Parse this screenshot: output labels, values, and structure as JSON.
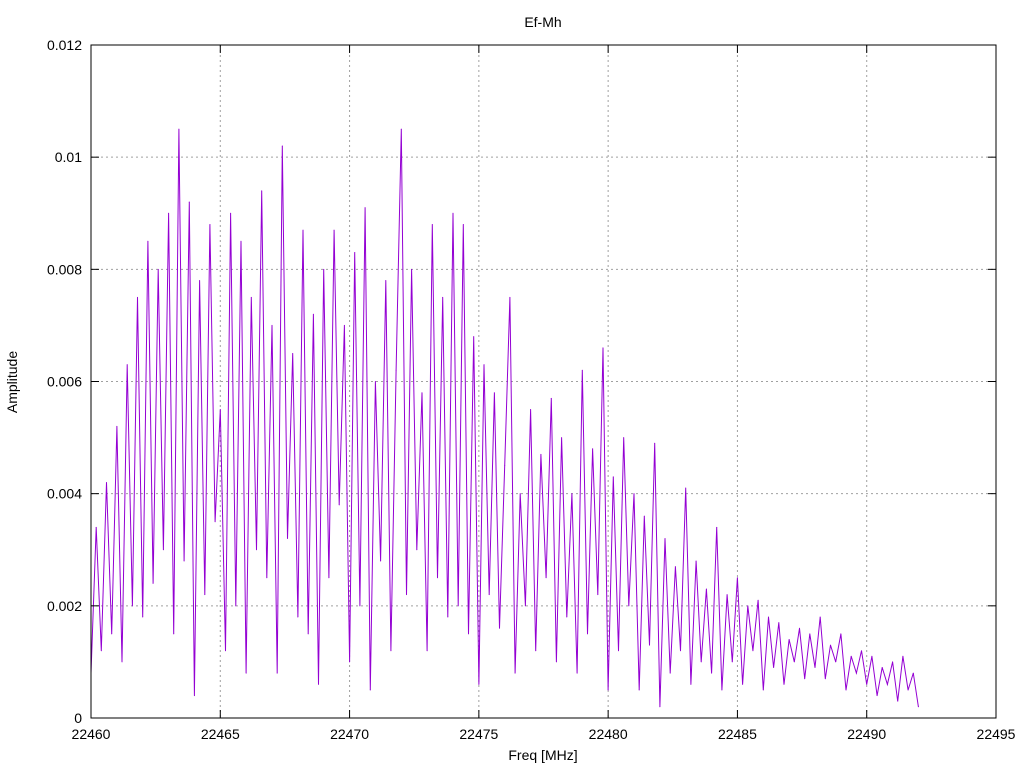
{
  "chart_data": {
    "type": "line",
    "title": "Ef-Mh",
    "xlabel": "Freq [MHz]",
    "ylabel": "Amplitude",
    "xlim": [
      22460,
      22495
    ],
    "ylim": [
      0,
      0.012
    ],
    "grid": true,
    "legend": "none",
    "xticks": [
      "22460",
      "22465",
      "22470",
      "22475",
      "22480",
      "22485",
      "22490",
      "22495"
    ],
    "yticks": [
      "0",
      "0.002",
      "0.004",
      "0.006",
      "0.008",
      "0.01",
      "0.012"
    ],
    "series": [
      {
        "name": "Ef-Mh",
        "color": "#9400D3",
        "x_start": 22460,
        "x_step": 0.2,
        "values": [
          0.0008,
          0.0034,
          0.0012,
          0.0042,
          0.0015,
          0.0052,
          0.001,
          0.0063,
          0.002,
          0.0075,
          0.0018,
          0.0085,
          0.0024,
          0.008,
          0.003,
          0.009,
          0.0015,
          0.0105,
          0.0028,
          0.0092,
          0.0004,
          0.0078,
          0.0022,
          0.0088,
          0.0035,
          0.0055,
          0.0012,
          0.009,
          0.002,
          0.0085,
          0.0008,
          0.0075,
          0.003,
          0.0094,
          0.0025,
          0.007,
          0.0008,
          0.0102,
          0.0032,
          0.0065,
          0.0018,
          0.0087,
          0.0015,
          0.0072,
          0.0006,
          0.008,
          0.0025,
          0.0087,
          0.0038,
          0.007,
          0.001,
          0.0083,
          0.002,
          0.0091,
          0.0005,
          0.006,
          0.0028,
          0.0078,
          0.0012,
          0.0062,
          0.0105,
          0.0022,
          0.008,
          0.003,
          0.0058,
          0.0012,
          0.0088,
          0.0025,
          0.0075,
          0.0018,
          0.009,
          0.002,
          0.0088,
          0.0015,
          0.0068,
          0.0006,
          0.0063,
          0.0022,
          0.0058,
          0.0016,
          0.0045,
          0.0075,
          0.0008,
          0.004,
          0.002,
          0.0055,
          0.0012,
          0.0047,
          0.0025,
          0.0057,
          0.001,
          0.005,
          0.0018,
          0.004,
          0.0008,
          0.0062,
          0.0015,
          0.0048,
          0.0022,
          0.0066,
          0.0005,
          0.0043,
          0.0012,
          0.005,
          0.002,
          0.004,
          0.0005,
          0.0036,
          0.0013,
          0.0049,
          0.0002,
          0.0032,
          0.0008,
          0.0027,
          0.0012,
          0.0041,
          0.0006,
          0.0028,
          0.001,
          0.0023,
          0.0008,
          0.0034,
          0.0005,
          0.0022,
          0.001,
          0.0025,
          0.0006,
          0.002,
          0.0012,
          0.0021,
          0.0005,
          0.0018,
          0.0009,
          0.0017,
          0.0006,
          0.0014,
          0.001,
          0.0016,
          0.0007,
          0.0015,
          0.0009,
          0.0018,
          0.0007,
          0.0013,
          0.001,
          0.0015,
          0.0005,
          0.0011,
          0.0008,
          0.0012,
          0.0006,
          0.0011,
          0.0004,
          0.0009,
          0.0006,
          0.001,
          0.0003,
          0.0011,
          0.0005,
          0.0008,
          0.0002
        ]
      }
    ]
  }
}
